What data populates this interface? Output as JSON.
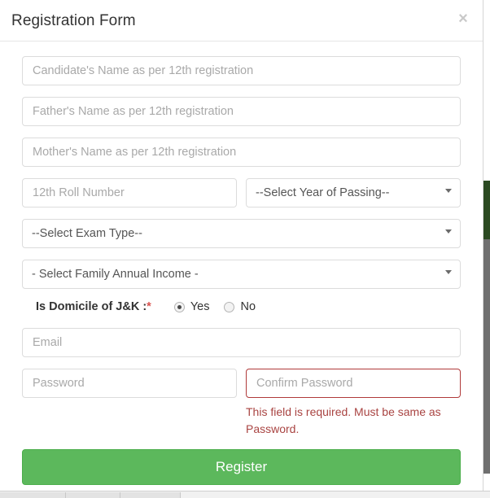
{
  "modal": {
    "title": "Registration Form",
    "close_label": "×"
  },
  "form": {
    "candidate_name_placeholder": "Candidate's Name as per 12th registration",
    "father_name_placeholder": "Father's Name as per 12th registration",
    "mother_name_placeholder": "Mother's Name as per 12th registration",
    "roll_number_placeholder": "12th Roll Number",
    "year_of_passing_selected": "--Select Year of Passing--",
    "exam_type_selected": "--Select Exam Type--",
    "family_income_selected": "- Select Family Annual Income -",
    "domicile_label": "Is Domicile of J&K :",
    "domicile_required_mark": "*",
    "domicile_options": [
      {
        "label": "Yes",
        "checked": true
      },
      {
        "label": "No",
        "checked": false
      }
    ],
    "email_placeholder": "Email",
    "password_placeholder": "Password",
    "confirm_password_placeholder": "Confirm Password",
    "confirm_password_error": "This field is required. Must be same as Password.",
    "submit_label": "Register"
  },
  "colors": {
    "submit_green": "#5cb85c",
    "error_red": "#a94442",
    "error_border": "#b03a3a",
    "required_star": "#d9534f",
    "border_gray": "#dcdcdc",
    "placeholder_gray": "#a9a9a9"
  }
}
